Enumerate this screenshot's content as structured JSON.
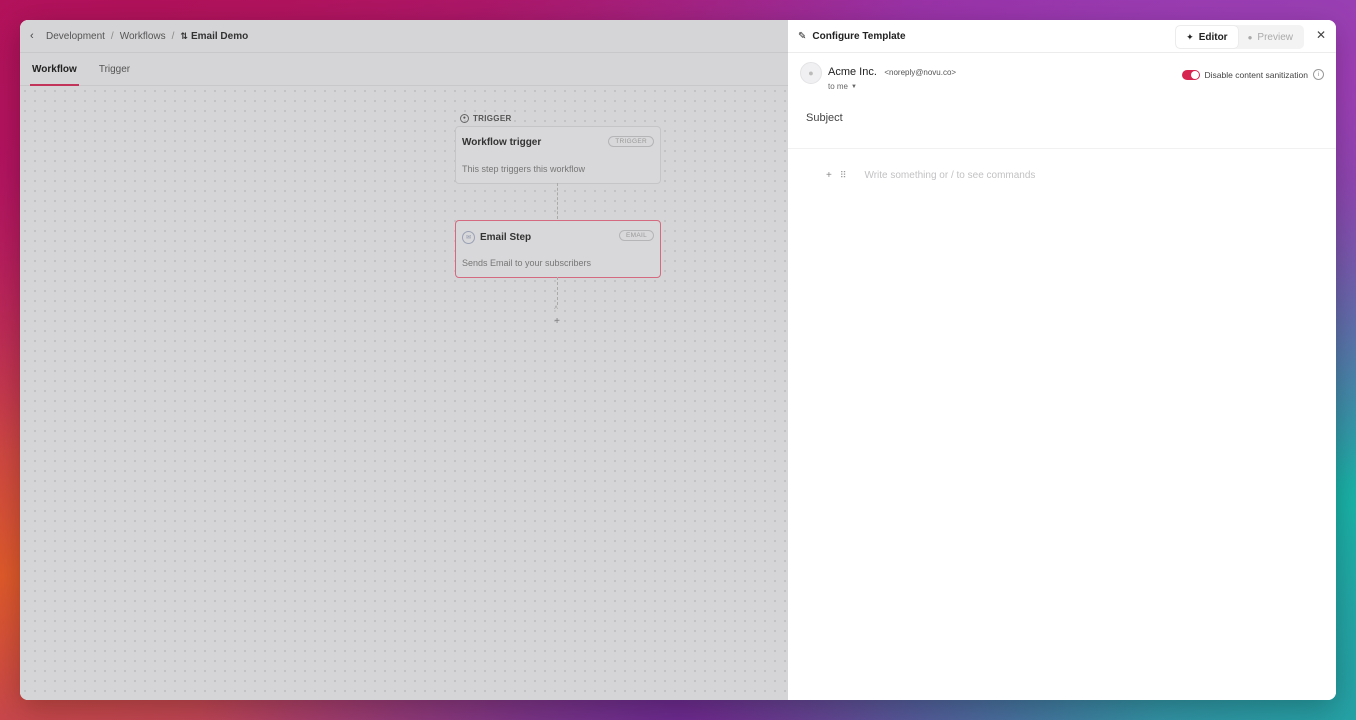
{
  "breadcrumb": {
    "back_icon": "chevron-left-icon",
    "items": [
      "Development",
      "Workflows"
    ],
    "separator": "/",
    "current": "Email Demo",
    "current_icon": "workflow-icon"
  },
  "tabs": [
    {
      "label": "Workflow",
      "active": true
    },
    {
      "label": "Trigger",
      "active": false
    }
  ],
  "canvas": {
    "trigger_section_label": "TRIGGER",
    "trigger_node": {
      "title": "Workflow trigger",
      "badge": "TRIGGER",
      "description": "This step triggers this workflow"
    },
    "email_node": {
      "title": "Email Step",
      "badge": "EMAIL",
      "description": "Sends Email to your subscribers"
    },
    "add_step_symbol": "+"
  },
  "panel": {
    "title": "Configure Template",
    "title_icon": "pencil-icon",
    "editor_label": "Editor",
    "preview_label": "Preview",
    "sender": {
      "name": "Acme Inc.",
      "email": "<noreply@novu.co>",
      "to_label": "to me"
    },
    "sanitization_label": "Disable content sanitization",
    "sanitization_enabled": true,
    "subject_placeholder": "Subject",
    "body_placeholder": "Write something or / to see commands",
    "accent_color": "#d6234f"
  }
}
